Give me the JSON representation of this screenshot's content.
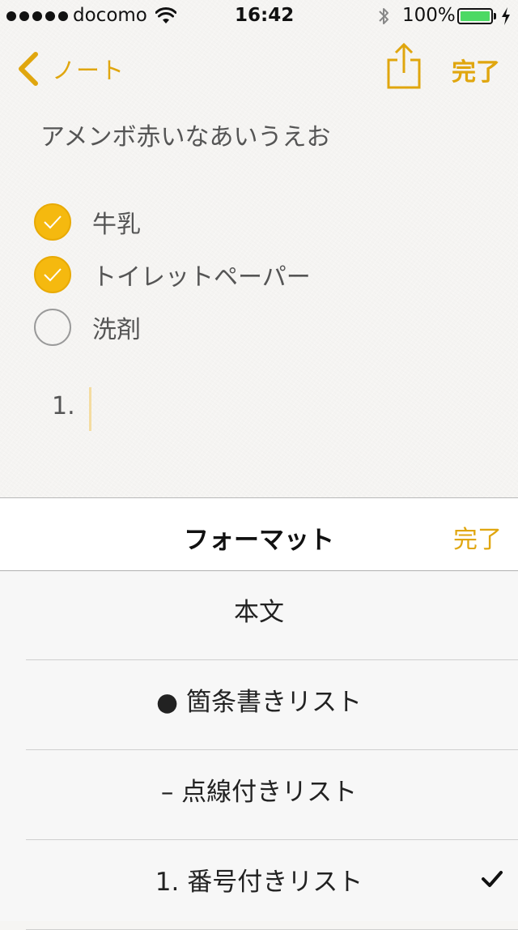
{
  "status_bar": {
    "carrier": "docomo",
    "time": "16:42",
    "battery_percent": "100%"
  },
  "nav": {
    "back_label": "ノート",
    "done_label": "完了"
  },
  "note": {
    "title": "アメンボ赤いなあいうえお",
    "checklist": [
      {
        "label": "牛乳",
        "checked": true
      },
      {
        "label": "トイレットペーパー",
        "checked": true
      },
      {
        "label": "洗剤",
        "checked": false
      }
    ],
    "numbered_item": "1."
  },
  "format_panel": {
    "title": "フォーマット",
    "done_label": "完了",
    "options": [
      {
        "label": "本文",
        "selected": false
      },
      {
        "label": "● 箇条書きリスト",
        "selected": false
      },
      {
        "label": "– 点線付きリスト",
        "selected": false
      },
      {
        "label": "1. 番号付きリスト",
        "selected": true
      }
    ]
  },
  "colors": {
    "accent": "#e0a60e",
    "check_fill": "#f5b90f",
    "battery": "#4cd964"
  }
}
